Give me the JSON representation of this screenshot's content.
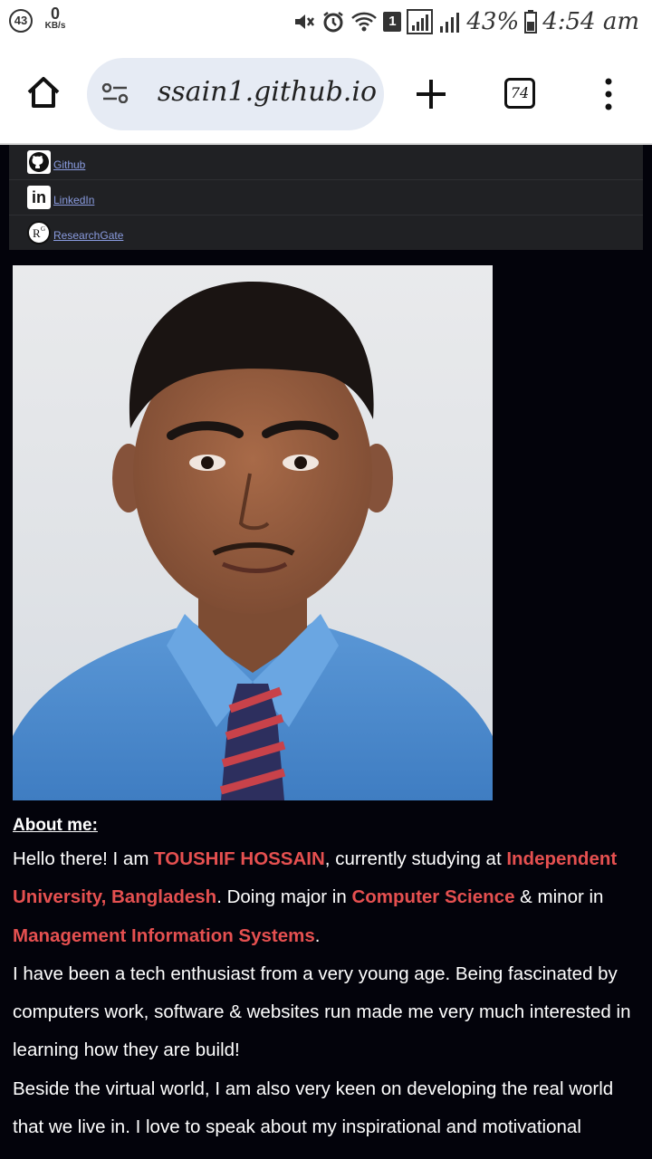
{
  "status_bar": {
    "notification_count": "43",
    "net_speed_value": "0",
    "net_speed_unit": "KB/s",
    "sim_slot": "1",
    "battery": "43%",
    "time": "4:54 am"
  },
  "browser": {
    "url": "ssain1.github.io",
    "tab_count": "74"
  },
  "social_links": [
    {
      "label": "Github",
      "icon": "github-icon"
    },
    {
      "label": "LinkedIn",
      "icon": "linkedin-icon"
    },
    {
      "label": "ResearchGate",
      "icon": "researchgate-icon"
    }
  ],
  "about": {
    "heading": "About me:",
    "p1": {
      "t1": "Hello there! I am ",
      "name": "TOUSHIF HOSSAIN",
      "t2": ", currently studying at ",
      "university": "Independent University, Bangladesh",
      "t3": ". Doing major in ",
      "major": "Computer Science",
      "t4": " & minor in ",
      "minor": "Management Information Systems",
      "t5": "."
    },
    "p2": "I have been a tech enthusiast from a very young age. Being fascinated by computers work, software & websites run made me very much interested in learning how they are build!",
    "p3": "Beside the virtual world, I am also very keen on developing the real world that we live in. I love to speak about my inspirational and motivational"
  },
  "colors": {
    "page_bg": "#03030b",
    "highlight": "#e55050",
    "link": "#8a9ce0",
    "social_bg": "#202124"
  }
}
